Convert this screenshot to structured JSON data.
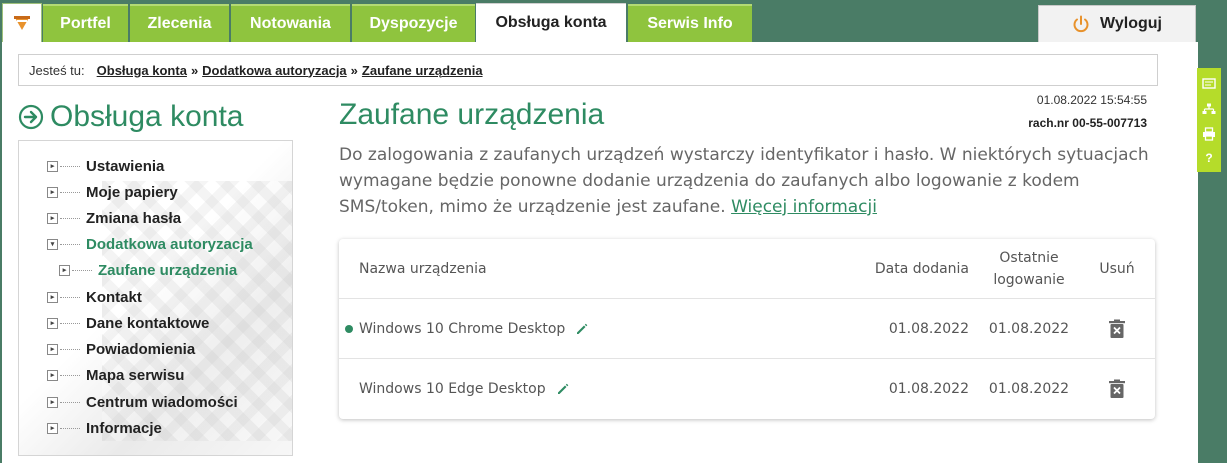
{
  "nav": {
    "tabs": [
      {
        "label": "Portfel"
      },
      {
        "label": "Zlecenia"
      },
      {
        "label": "Notowania"
      },
      {
        "label": "Dyspozycje"
      },
      {
        "label": "Obsługa konta"
      },
      {
        "label": "Serwis Info"
      }
    ],
    "logout_label": "Wyloguj"
  },
  "breadcrumb": {
    "prefix": "Jesteś tu:",
    "items": [
      "Obsługa konta",
      "Dodatkowa autoryzacja",
      "Zaufane urządzenia"
    ],
    "separator": "»"
  },
  "sidebar": {
    "title": "Obsługa konta",
    "items": [
      {
        "label": "Ustawienia"
      },
      {
        "label": "Moje papiery"
      },
      {
        "label": "Zmiana hasła"
      },
      {
        "label": "Dodatkowa autoryzacja"
      },
      {
        "label": "Zaufane urządzenia"
      },
      {
        "label": "Kontakt"
      },
      {
        "label": "Dane kontaktowe"
      },
      {
        "label": "Powiadomienia"
      },
      {
        "label": "Mapa serwisu"
      },
      {
        "label": "Centrum wiadomości"
      },
      {
        "label": "Informacje"
      }
    ]
  },
  "main": {
    "title": "Zaufane urządzenia",
    "datetime": "01.08.2022 15:54:55",
    "account": "rach.nr 00-55-007713",
    "description": "Do zalogowania z zaufanych urządzeń wystarczy identyfikator i hasło. W niektórych sytuacjach wymagane będzie ponowne dodanie urządzenia do zaufanych albo logowanie z kodem SMS/token, mimo że urządzenie jest zaufane.",
    "more_link": "Więcej informacji"
  },
  "table": {
    "headers": {
      "name": "Nazwa urządzenia",
      "added": "Data dodania",
      "last_login": "Ostatnie logowanie",
      "delete": "Usuń"
    },
    "rows": [
      {
        "name": "Windows 10 Chrome Desktop",
        "added": "01.08.2022",
        "last_login": "01.08.2022",
        "current": true
      },
      {
        "name": "Windows 10 Edge Desktop",
        "added": "01.08.2022",
        "last_login": "01.08.2022",
        "current": false
      }
    ]
  },
  "colors": {
    "brand_green": "#2e8b62",
    "nav_green": "#8fc43e",
    "dark_green": "#4a7c66",
    "tool_lime": "#b5dc2a"
  },
  "icons": {
    "logo": "home-logo-icon",
    "logout": "power-icon",
    "sidebar_title": "circle-arrow-right-icon",
    "edit": "pencil-icon",
    "delete": "trash-icon",
    "tools": [
      "message-icon",
      "sitemap-icon",
      "print-icon",
      "help-icon"
    ]
  }
}
